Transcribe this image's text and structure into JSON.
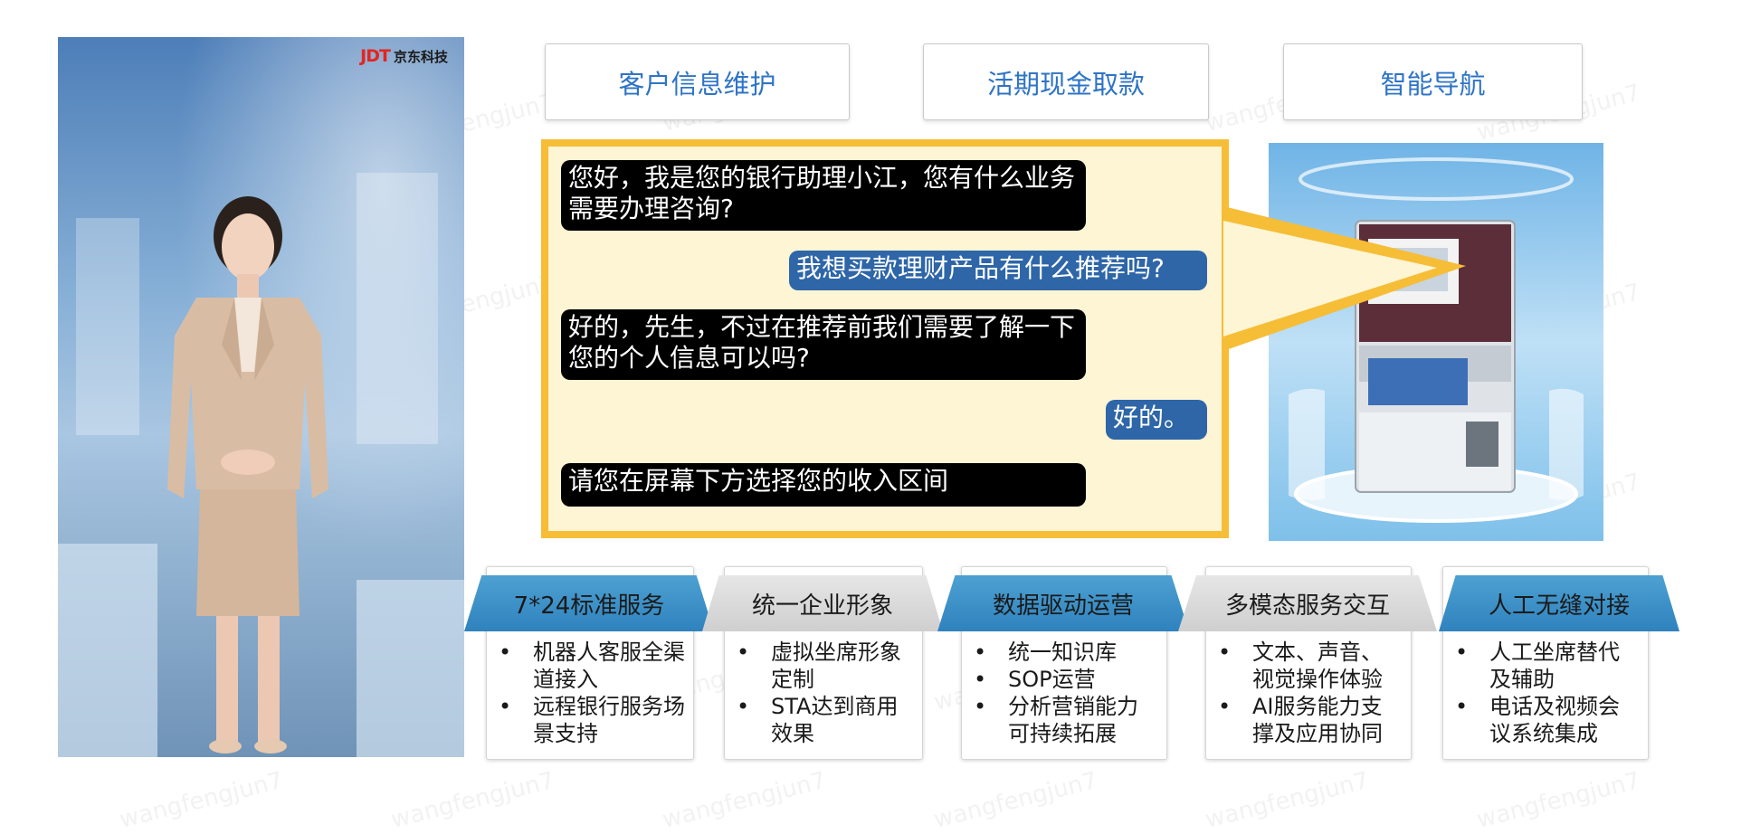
{
  "brand": {
    "logo": "JDT",
    "name": "京东科技"
  },
  "tabs": [
    "客户信息维护",
    "活期现金取款",
    "智能导航"
  ],
  "chat": [
    {
      "role": "bot",
      "text": "您好，我是您的银行助理小江，您有什么业务需要办理咨询?"
    },
    {
      "role": "user",
      "text": "我想买款理财产品有什么推荐吗?"
    },
    {
      "role": "bot",
      "text": "好的，先生，不过在推荐前我们需要了解一下您的个人信息可以吗?"
    },
    {
      "role": "user",
      "text": "好的。"
    },
    {
      "role": "bot",
      "text": "请您在屏幕下方选择您的收入区间"
    }
  ],
  "features": [
    {
      "title": "7*24标准服务",
      "style": "blue",
      "items": [
        "机器人客服全渠道接入",
        "远程银行服务场景支持"
      ]
    },
    {
      "title": "统一企业形象",
      "style": "gray",
      "items": [
        "虚拟坐席形象定制",
        "STA达到商用效果"
      ]
    },
    {
      "title": "数据驱动运营",
      "style": "blue",
      "items": [
        "统一知识库",
        "SOP运营",
        "分析营销能力可持续拓展"
      ]
    },
    {
      "title": "多模态服务交互",
      "style": "gray",
      "items": [
        "文本、声音、视觉操作体验",
        "AI服务能力支撑及应用协同"
      ]
    },
    {
      "title": "人工无缝对接",
      "style": "blue",
      "items": [
        "人工坐席替代及辅助",
        "电话及视频会议系统集成"
      ]
    }
  ],
  "watermark": "wangfengjun7",
  "colors": {
    "tab_text": "#2f74c5",
    "chat_border": "#f6bd37",
    "chat_bg": "#fdf5d4",
    "user_bubble": "#2e66a8",
    "bot_bubble": "#000000",
    "ribbon_blue": "#3a8fc7"
  }
}
